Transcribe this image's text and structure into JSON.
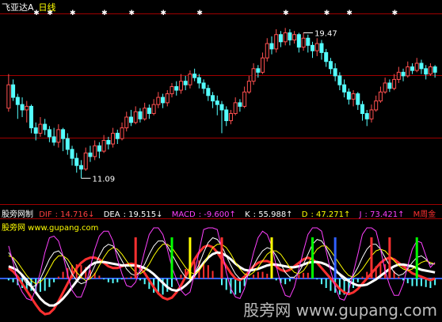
{
  "window": {
    "title": "飞亚达A",
    "period": "日线"
  },
  "legend": {
    "panel_name": "股旁网制",
    "site": "股旁网 www.gupang.com"
  },
  "indicators": [
    {
      "name": "DIF",
      "value": "14.716↓",
      "color": "#ff4040"
    },
    {
      "name": "DEA",
      "value": "19.515↓",
      "color": "#ffffff"
    },
    {
      "name": "MACD",
      "value": "-9.600↑",
      "color": "#ff40ff"
    },
    {
      "name": "K",
      "value": "55.988↑",
      "color": "#ffffff"
    },
    {
      "name": "D",
      "value": "47.271↑",
      "color": "#ffff00"
    },
    {
      "name": "J",
      "value": "73.421↑",
      "color": "#ff40ff"
    }
  ],
  "extra_label": "M周金",
  "watermark": "股旁网 www.gupang.com",
  "colors": {
    "up": "#ff5050",
    "down": "#54ffff",
    "grid": "#a00000",
    "bg": "#000000"
  },
  "chart_data": [
    {
      "type": "candlestick",
      "ylim": [
        10.0,
        20.5
      ],
      "high_label": "19.47",
      "low_label": "11.09",
      "high_index": 65,
      "low_index": 16,
      "candles": [
        [
          15.0,
          16.3,
          16.9,
          14.8
        ],
        [
          16.3,
          15.6,
          16.6,
          15.4
        ],
        [
          15.6,
          15.2,
          15.8,
          14.4
        ],
        [
          15.2,
          14.9,
          15.6,
          14.5
        ],
        [
          14.9,
          15.1,
          15.4,
          14.2
        ],
        [
          15.1,
          13.9,
          15.2,
          13.6
        ],
        [
          13.9,
          13.6,
          14.2,
          13.2
        ],
        [
          13.6,
          14.1,
          14.5,
          13.4
        ],
        [
          14.1,
          13.8,
          14.4,
          13.5
        ],
        [
          13.8,
          13.4,
          14.0,
          13.1
        ],
        [
          13.4,
          13.1,
          13.9,
          12.9
        ],
        [
          13.1,
          13.8,
          14.1,
          12.8
        ],
        [
          13.8,
          13.3,
          13.9,
          12.6
        ],
        [
          13.3,
          12.7,
          13.6,
          12.4
        ],
        [
          12.7,
          12.2,
          12.9,
          11.8
        ],
        [
          12.2,
          11.8,
          12.5,
          11.4
        ],
        [
          11.8,
          11.6,
          12.1,
          11.09
        ],
        [
          11.6,
          12.5,
          12.8,
          11.5
        ],
        [
          12.5,
          12.3,
          12.9,
          12.0
        ],
        [
          12.3,
          12.9,
          13.2,
          12.1
        ],
        [
          12.9,
          12.6,
          13.1,
          12.2
        ],
        [
          12.6,
          13.2,
          13.5,
          12.5
        ],
        [
          13.2,
          13.0,
          13.4,
          12.7
        ],
        [
          13.0,
          13.6,
          13.9,
          12.8
        ],
        [
          13.6,
          13.3,
          13.8,
          13.0
        ],
        [
          13.3,
          13.9,
          14.2,
          13.2
        ],
        [
          13.9,
          14.5,
          14.8,
          13.7
        ],
        [
          14.5,
          14.2,
          14.9,
          14.0
        ],
        [
          14.2,
          14.8,
          15.1,
          14.1
        ],
        [
          14.8,
          14.4,
          15.0,
          14.2
        ],
        [
          14.4,
          15.0,
          15.3,
          14.3
        ],
        [
          15.0,
          14.7,
          15.2,
          14.4
        ],
        [
          14.7,
          15.2,
          15.5,
          14.6
        ],
        [
          15.2,
          15.6,
          15.9,
          15.0
        ],
        [
          15.6,
          15.3,
          15.8,
          15.0
        ],
        [
          15.3,
          15.8,
          16.0,
          15.1
        ],
        [
          15.8,
          16.2,
          16.4,
          15.6
        ],
        [
          16.2,
          16.0,
          16.5,
          15.7
        ],
        [
          16.0,
          16.5,
          16.9,
          15.8
        ],
        [
          16.5,
          16.3,
          16.8,
          16.0
        ],
        [
          16.3,
          16.9,
          17.1,
          16.1
        ],
        [
          16.9,
          16.7,
          17.2,
          16.5
        ],
        [
          16.7,
          16.4,
          16.9,
          16.1
        ],
        [
          16.4,
          16.1,
          16.6,
          15.8
        ],
        [
          16.1,
          15.7,
          16.3,
          15.4
        ],
        [
          15.7,
          15.4,
          15.9,
          15.0
        ],
        [
          15.4,
          15.2,
          15.7,
          14.6
        ],
        [
          15.2,
          14.9,
          15.4,
          13.6
        ],
        [
          14.9,
          14.3,
          15.1,
          14.0
        ],
        [
          14.3,
          14.7,
          14.9,
          14.1
        ],
        [
          14.7,
          15.3,
          15.6,
          14.6
        ],
        [
          15.3,
          15.1,
          15.5,
          14.8
        ],
        [
          15.1,
          15.9,
          16.2,
          15.0
        ],
        [
          15.9,
          16.5,
          16.8,
          15.8
        ],
        [
          16.5,
          17.2,
          17.5,
          16.3
        ],
        [
          17.2,
          17.0,
          17.4,
          16.7
        ],
        [
          17.0,
          17.8,
          18.1,
          16.9
        ],
        [
          17.8,
          18.6,
          18.9,
          17.6
        ],
        [
          18.6,
          18.3,
          19.0,
          18.0
        ],
        [
          18.3,
          19.1,
          19.4,
          18.1
        ],
        [
          19.1,
          18.7,
          19.3,
          18.4
        ],
        [
          18.7,
          19.2,
          19.47,
          18.5
        ],
        [
          19.2,
          18.8,
          19.4,
          18.5
        ],
        [
          18.8,
          19.1,
          19.3,
          18.6
        ],
        [
          19.1,
          18.4,
          19.2,
          18.1
        ],
        [
          18.4,
          18.9,
          19.2,
          18.2
        ],
        [
          18.9,
          18.5,
          19.1,
          18.1
        ],
        [
          18.5,
          18.2,
          18.7,
          17.8
        ],
        [
          18.2,
          18.6,
          18.9,
          17.9
        ],
        [
          18.6,
          18.1,
          18.8,
          17.7
        ],
        [
          18.1,
          17.6,
          18.3,
          17.3
        ],
        [
          17.6,
          17.2,
          17.8,
          16.9
        ],
        [
          17.2,
          16.8,
          17.5,
          16.5
        ],
        [
          16.8,
          16.3,
          17.0,
          16.0
        ],
        [
          16.3,
          15.9,
          16.6,
          15.6
        ],
        [
          15.9,
          15.5,
          16.1,
          15.2
        ],
        [
          15.5,
          15.8,
          16.0,
          15.1
        ],
        [
          15.8,
          15.2,
          15.9,
          14.9
        ],
        [
          15.2,
          14.7,
          15.4,
          14.3
        ],
        [
          14.7,
          14.4,
          14.9,
          14.0
        ],
        [
          14.4,
          14.9,
          15.2,
          14.2
        ],
        [
          14.9,
          15.4,
          15.7,
          14.8
        ],
        [
          15.4,
          15.9,
          16.2,
          15.3
        ],
        [
          15.9,
          16.4,
          16.7,
          15.8
        ],
        [
          16.4,
          16.1,
          16.6,
          15.9
        ],
        [
          16.1,
          16.6,
          16.9,
          16.0
        ],
        [
          16.6,
          17.0,
          17.3,
          16.4
        ],
        [
          17.0,
          16.8,
          17.2,
          16.5
        ],
        [
          16.8,
          17.3,
          17.6,
          16.7
        ],
        [
          17.3,
          17.1,
          17.5,
          16.9
        ],
        [
          17.1,
          17.5,
          17.8,
          17.0
        ],
        [
          17.5,
          17.2,
          17.7,
          16.9
        ],
        [
          17.2,
          16.9,
          17.4,
          16.6
        ],
        [
          16.9,
          17.3,
          17.5,
          16.8
        ],
        [
          17.3,
          17.0,
          17.4,
          16.7
        ]
      ]
    },
    {
      "type": "line",
      "series": [
        {
          "name": "DIF",
          "color": "#ff3030",
          "values": [
            12,
            8,
            2,
            -6,
            -14,
            -22,
            -30,
            -37,
            -41,
            -40,
            -35,
            -26,
            -16,
            -6,
            4,
            12,
            18,
            22,
            24,
            24,
            22,
            18,
            14,
            12,
            12,
            14,
            16,
            17,
            16,
            12,
            6,
            -2,
            -10,
            -17,
            -22,
            -24,
            -22,
            -16,
            -8,
            2,
            12,
            22,
            30,
            36,
            38,
            36,
            30,
            22,
            14,
            6,
            0,
            -2,
            2,
            8,
            14,
            18,
            20,
            20,
            18,
            14,
            10,
            8,
            10,
            14,
            18,
            22,
            24,
            22,
            18,
            12,
            6,
            0,
            -6,
            -12,
            -16,
            -18,
            -16,
            -12,
            -6,
            0,
            6,
            12,
            18,
            22,
            24,
            22,
            18,
            14,
            10,
            6,
            4,
            2,
            0,
            -2,
            0
          ]
        },
        {
          "name": "DEA",
          "color": "#ffffff",
          "values": [
            14,
            12,
            9,
            4,
            -2,
            -9,
            -16,
            -23,
            -28,
            -31,
            -31,
            -28,
            -23,
            -17,
            -10,
            -3,
            4,
            10,
            15,
            18,
            19,
            19,
            18,
            17,
            16,
            15,
            15,
            15,
            15,
            14,
            12,
            9,
            5,
            0,
            -5,
            -10,
            -13,
            -14,
            -12,
            -8,
            -3,
            4,
            11,
            18,
            24,
            28,
            30,
            29,
            26,
            22,
            17,
            13,
            10,
            9,
            10,
            11,
            13,
            15,
            16,
            16,
            15,
            14,
            13,
            13,
            14,
            16,
            18,
            19,
            19,
            18,
            16,
            13,
            9,
            5,
            1,
            -3,
            -6,
            -8,
            -8,
            -7,
            -4,
            -1,
            3,
            7,
            11,
            14,
            16,
            16,
            15,
            14,
            12,
            10,
            9,
            8,
            7
          ]
        },
        {
          "name": "K",
          "color": "#ffffff",
          "values": [
            70,
            62,
            50,
            40,
            32,
            28,
            30,
            38,
            50,
            62,
            70,
            72,
            66,
            56,
            44,
            36,
            32,
            34,
            42,
            54,
            66,
            76,
            80,
            78,
            70,
            60,
            50,
            44,
            42,
            46,
            56,
            68,
            78,
            84,
            84,
            78,
            68,
            58,
            48,
            40,
            38,
            44,
            56,
            70,
            82,
            88,
            86,
            78,
            66,
            54,
            44,
            38,
            38,
            44,
            54,
            64,
            72,
            76,
            74,
            66,
            56,
            46,
            40,
            40,
            46,
            56,
            68,
            80,
            86,
            84,
            76,
            64,
            52,
            42,
            36,
            36,
            42,
            52,
            64,
            74,
            80,
            80,
            74,
            64,
            54,
            46,
            42,
            44,
            50,
            58,
            64,
            66,
            62,
            56,
            56
          ]
        },
        {
          "name": "D",
          "color": "#ffff00",
          "values": [
            66,
            64,
            58,
            50,
            42,
            36,
            32,
            34,
            40,
            50,
            60,
            66,
            66,
            62,
            54,
            46,
            40,
            36,
            38,
            44,
            54,
            64,
            72,
            76,
            74,
            68,
            60,
            52,
            46,
            44,
            48,
            56,
            66,
            74,
            80,
            80,
            76,
            68,
            60,
            52,
            46,
            44,
            48,
            56,
            66,
            76,
            80,
            80,
            76,
            68,
            58,
            50,
            44,
            42,
            46,
            52,
            60,
            68,
            72,
            72,
            68,
            60,
            52,
            46,
            44,
            48,
            56,
            66,
            74,
            78,
            78,
            72,
            64,
            56,
            48,
            42,
            40,
            44,
            50,
            58,
            66,
            72,
            74,
            72,
            66,
            60,
            54,
            50,
            48,
            50,
            54,
            58,
            60,
            58,
            56
          ]
        },
        {
          "name": "J",
          "color": "#ff40ff",
          "values": [
            78,
            58,
            34,
            22,
            14,
            12,
            26,
            46,
            70,
            88,
            90,
            84,
            66,
            44,
            24,
            16,
            16,
            30,
            52,
            74,
            90,
            96,
            96,
            84,
            62,
            44,
            30,
            28,
            34,
            50,
            72,
            92,
            100,
            100,
            92,
            74,
            52,
            38,
            24,
            18,
            22,
            44,
            72,
            98,
            100,
            100,
            98,
            74,
            46,
            26,
            16,
            14,
            26,
            48,
            70,
            88,
            96,
            92,
            78,
            54,
            32,
            18,
            16,
            28,
            50,
            72,
            92,
            100,
            100,
            96,
            72,
            48,
            28,
            14,
            12,
            24,
            46,
            68,
            92,
            100,
            100,
            96,
            74,
            48,
            30,
            18,
            18,
            32,
            54,
            74,
            84,
            82,
            66,
            52,
            58
          ]
        }
      ]
    }
  ]
}
